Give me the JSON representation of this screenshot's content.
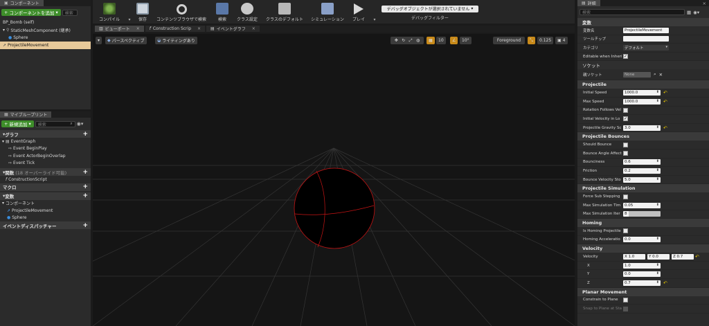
{
  "components_panel": {
    "tab": "コンポーネント",
    "add_button": "コンポーネントを追加",
    "search_placeholder": "検索",
    "root": "BP_Bomb (self)",
    "items": [
      {
        "label": "StaticMeshComponent (継承)"
      },
      {
        "label": "Sphere"
      },
      {
        "label": "ProjectileMovement"
      }
    ]
  },
  "myblueprint": {
    "tab": "マイブループリント",
    "add_button": "新規追加",
    "search_placeholder": "検索",
    "sections": {
      "graph": "グラフ",
      "event_graph": "EventGraph",
      "events": [
        "Event BeginPlay",
        "Event ActorBeginOverlap",
        "Event Tick"
      ],
      "functions": "関数",
      "functions_note": "(18 オーバーライド可能)",
      "construction": "ConstructionScript",
      "macros": "マクロ",
      "variables": "変数",
      "components": "コンポーネント",
      "comp_items": [
        "ProjectileMovement",
        "Sphere"
      ],
      "dispatchers": "イベントディスパッチャー"
    }
  },
  "toolbar": {
    "compile": "コンパイル",
    "save": "保存",
    "browse": "コンテンツブラウザで検索",
    "search": "検索",
    "class_settings": "クラス設定",
    "class_defaults": "クラスのデフォルト",
    "simulation": "シミュレーション",
    "play": "プレイ",
    "debug_select": "デバッグオブジェクトが選択されていません",
    "debug_filter": "デバッグフィルター"
  },
  "editor_tabs": [
    "ビューポート",
    "Construction Scrip",
    "イベントグラフ"
  ],
  "viewport": {
    "perspective": "パースペクティブ",
    "lighting": "ライティングあり",
    "grid_value": "10",
    "angle_value": "10°",
    "foreground": "Foreground",
    "scale_value": "0.125",
    "speed_value": "4"
  },
  "details": {
    "tab": "詳細",
    "search_placeholder": "検索",
    "variable": {
      "title": "変数",
      "name_label": "変数名",
      "name_value": "ProjectileMovement",
      "tooltip_label": "ツールチップ",
      "category_label": "カテゴリ",
      "category_value": "デフォルト",
      "editable_label": "Editable when Inheri"
    },
    "socket": {
      "title": "ソケット",
      "parent_label": "親ソケット",
      "parent_value": "None"
    },
    "projectile": {
      "title": "Projectile",
      "initial_speed_label": "Initial Speed",
      "initial_speed": "1000.0",
      "max_speed_label": "Max Speed",
      "max_speed": "1000.0",
      "rotation_label": "Rotation Follows Vel",
      "initial_local_label": "Initial Velocity in Lo",
      "gravity_label": "Projectile Gravity Sc",
      "gravity": "3.0"
    },
    "bounces": {
      "title": "Projectile Bounces",
      "should_bounce_label": "Should Bounce",
      "angle_label": "Bounce Angle Affect",
      "bounciness_label": "Bounciness",
      "bounciness": "0.6",
      "friction_label": "Friction",
      "friction": "0.2",
      "stop_label": "Bounce Velocity Sto",
      "stop": "5.0"
    },
    "simulation": {
      "title": "Projectile Simulation",
      "substep_label": "Force Sub Stepping",
      "max_time_label": "Max Simulation Tim",
      "max_time": "0.05",
      "max_iter_label": "Max Simulation Iter",
      "max_iter": "8"
    },
    "homing": {
      "title": "Homing",
      "is_homing_label": "Is Homing Projectile",
      "accel_label": "Homing Acceleratio",
      "accel": "0.0"
    },
    "velocity": {
      "title": "Velocity",
      "label": "Velocity",
      "x_text": "X  1.0",
      "y_text": "Y  0.0",
      "z_text": "Z  0.7",
      "x_label": "X",
      "x": "1.0",
      "y_label": "Y",
      "y": "0.0",
      "z_label": "Z",
      "z": "0.7"
    },
    "planar": {
      "title": "Planar Movement",
      "constrain_label": "Constrain to Plane",
      "snap_label": "Snap to Plane at Sta"
    }
  },
  "colors": {
    "accent_green": "#3e8e2a",
    "selected_row": "#e7c99a",
    "grid_line": "#3c3c3c",
    "sphere_wire": "#c81414"
  }
}
